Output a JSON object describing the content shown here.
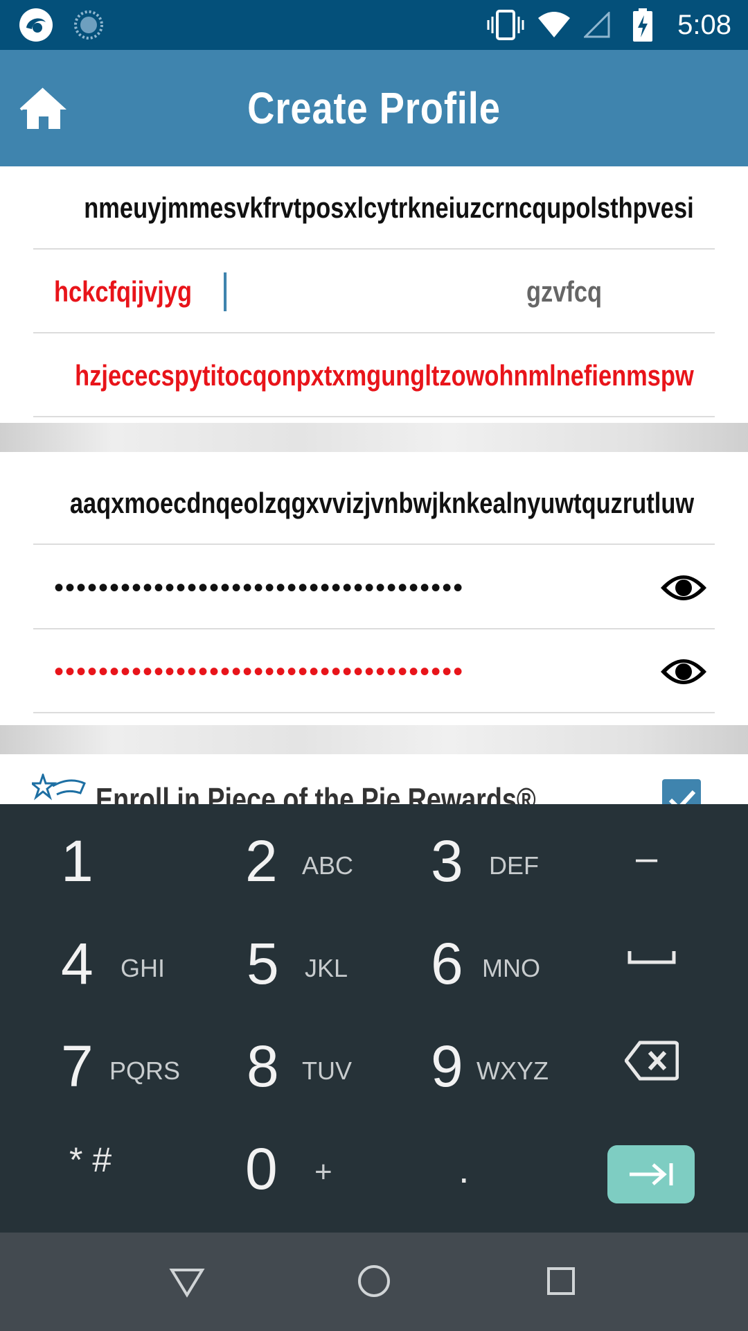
{
  "status_bar": {
    "time": "5:08",
    "left_icons": [
      "app-logo-icon",
      "loading-spinner-icon"
    ],
    "right_icons": [
      "vibrate-icon",
      "wifi-icon",
      "cell-signal-icon",
      "battery-charging-icon"
    ]
  },
  "app_bar": {
    "title": "Create Profile",
    "home_icon": "home-icon"
  },
  "form": {
    "field_1": "nmeuyjmmesvkfrvtposxlcytrkneiuzcrncqupolsthpvesi",
    "field_2_left": "hckcfqijvjyg",
    "field_2_right": "gzvfcq",
    "field_3": "hzjececspytitocqonpxtxmgungltzowohnmlnefienmspw",
    "field_4": "aaqxmoecdnqeolzqgxvvizjvnbwjknkealnyuwtquzrutluw",
    "password": "•••••••••••••••••••••••••••••••••••••",
    "confirm_password": "•••••••••••••••••••••••••••••••••••••"
  },
  "rewards": {
    "label": "Enroll in Piece of the Pie Rewards®",
    "checked": true
  },
  "keyboard": {
    "keys": [
      {
        "num": "1",
        "letters": ""
      },
      {
        "num": "2",
        "letters": "ABC"
      },
      {
        "num": "3",
        "letters": "DEF"
      },
      {
        "num": "–",
        "letters": ""
      },
      {
        "num": "4",
        "letters": "GHI"
      },
      {
        "num": "5",
        "letters": "JKL"
      },
      {
        "num": "6",
        "letters": "MNO"
      },
      {
        "num": "␣",
        "letters": ""
      },
      {
        "num": "7",
        "letters": "PQRS"
      },
      {
        "num": "8",
        "letters": "TUV"
      },
      {
        "num": "9",
        "letters": "WXYZ"
      },
      {
        "num": "⌫",
        "letters": ""
      },
      {
        "num": "* #",
        "letters": ""
      },
      {
        "num": "0",
        "letters": "+"
      },
      {
        "num": ".",
        "letters": ""
      }
    ]
  },
  "colors": {
    "status_bar": "#04507a",
    "app_bar": "#3f84ae",
    "error_red": "#e8141a",
    "keyboard_bg": "#263238",
    "go_key": "#7ecdc2",
    "nav_bar": "#434a50"
  }
}
